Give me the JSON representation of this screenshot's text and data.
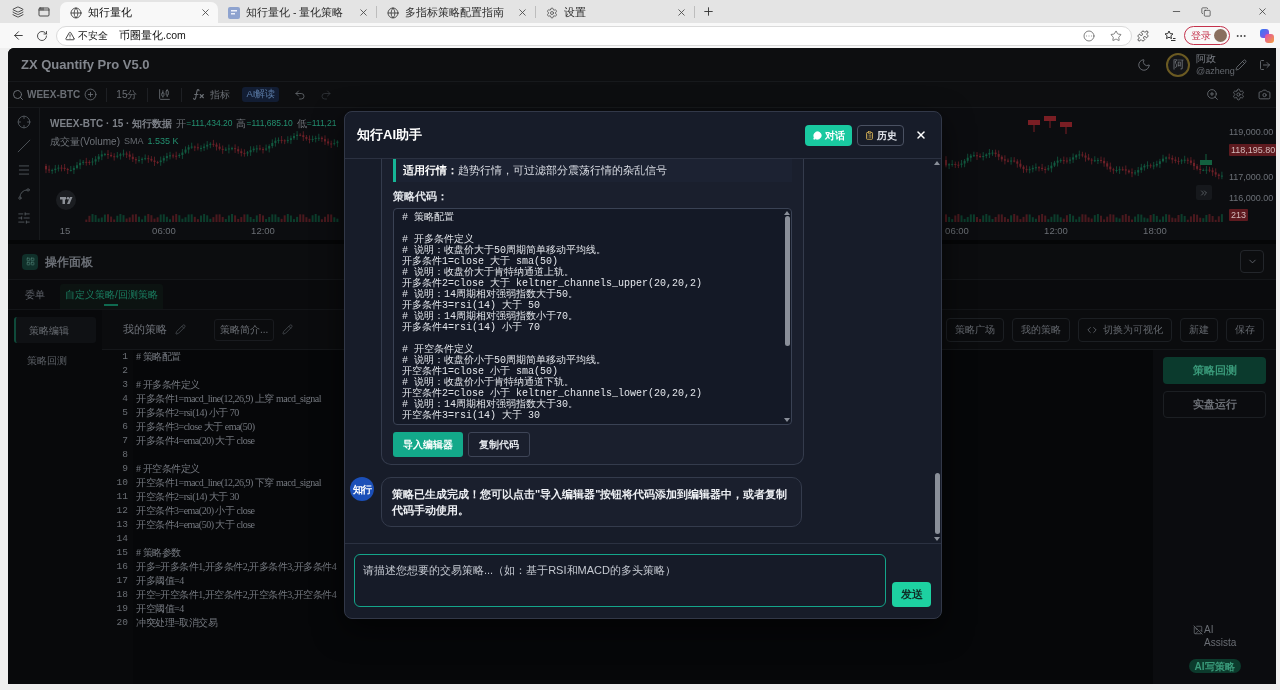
{
  "browser": {
    "tabs": [
      {
        "title": "知行量化",
        "selected": true
      },
      {
        "title": "知行量化 - 量化策略",
        "selected": false
      },
      {
        "title": "多指标策略配置指南",
        "selected": false
      },
      {
        "title": "设置",
        "selected": false
      }
    ],
    "security": "不安全",
    "url": "币圈量化.com",
    "login": "登录"
  },
  "app": {
    "title": "ZX Quantify Pro V5.0",
    "user": {
      "initial": "阿",
      "name": "阿政",
      "handle": "@azheng"
    }
  },
  "toolbar": {
    "symbol": "WEEX-BTC",
    "interval": "15分",
    "indicators": "指标",
    "ai_button": "AI解读"
  },
  "chart": {
    "title": "WEEX-BTC · 15 · 知行数据",
    "ohlc": [
      {
        "label": "开",
        "value": "=111,434.20"
      },
      {
        "label": "高",
        "value": "=111,685.10"
      },
      {
        "label": "低",
        "value": "=111,21"
      }
    ],
    "volume": {
      "label": "成交量(Volume)",
      "ma": "SMA",
      "value": "1.535 K"
    },
    "price_labels": [
      {
        "text": "119,000.00",
        "kind": "tick"
      },
      {
        "text": "118,195.80",
        "kind": "badge"
      },
      {
        "text": "117,000.00",
        "kind": "tick"
      },
      {
        "text": "116,000.00",
        "kind": "tick"
      },
      {
        "text": "213",
        "kind": "badge"
      }
    ],
    "time_labels_left": [
      "15",
      "06:00",
      "12:00"
    ],
    "time_labels_right": [
      "06:00",
      "12:00",
      "18:00"
    ]
  },
  "panel": {
    "title": "操作面板",
    "tabs": [
      {
        "label": "委单",
        "selected": false
      },
      {
        "label": "自定义策略/回测策略",
        "selected": true
      }
    ],
    "side_menu": [
      {
        "label": "策略编辑",
        "selected": true
      },
      {
        "label": "策略回测",
        "selected": false
      }
    ],
    "strategy_name": "我的策略",
    "description": "策略简介...",
    "actions": [
      {
        "label": "策略广场"
      },
      {
        "label": "我的策略"
      },
      {
        "label": "切换为可视化"
      },
      {
        "label": "新建"
      },
      {
        "label": "保存"
      }
    ],
    "editor": [
      {
        "number": "1",
        "text": "# 策略配置"
      },
      {
        "number": "2"
      },
      {
        "number": "3",
        "text": "# 开多条件定义"
      },
      {
        "number": "4",
        "text": "开多条件1=macd_line(12,26,9) 上穿 macd_signal"
      },
      {
        "number": "5",
        "text": "开多条件2=rsi(14) 小于 70"
      },
      {
        "number": "6",
        "text": "开多条件3=close 大于 ema(50)"
      },
      {
        "number": "7",
        "text": "开多条件4=ema(20) 大于 close"
      },
      {
        "number": "8"
      },
      {
        "number": "9",
        "text": "# 开空条件定义"
      },
      {
        "number": "10",
        "text": "开空条件1=macd_line(12,26,9) 下穿 macd_signal"
      },
      {
        "number": "11",
        "text": "开空条件2=rsi(14) 大于 30"
      },
      {
        "number": "12",
        "text": "开空条件3=ema(20) 小于 close"
      },
      {
        "number": "13",
        "text": "开空条件4=ema(50) 大于 close"
      },
      {
        "number": "14"
      },
      {
        "number": "15",
        "text": "# 策略参数"
      },
      {
        "number": "16",
        "text": "开多=开多条件1,开多条件2,开多条件3,开多条件4"
      },
      {
        "number": "17",
        "text": "开多阈值=4"
      },
      {
        "number": "18",
        "text": "开空=开空条件1,开空条件2,开空条件3,开空条件4"
      },
      {
        "number": "19",
        "text": "开空阈值=4"
      },
      {
        "number": "20",
        "text": "冲突处理=取消交易"
      }
    ],
    "run_buttons": [
      {
        "label": "策略回测",
        "kind": "primary"
      },
      {
        "label": "实盘运行",
        "kind": "outline"
      }
    ],
    "assistant": {
      "alt_text": "AI Assista",
      "badge": "AI写策略"
    }
  },
  "dialog": {
    "title": "知行AI助手",
    "tabs": [
      {
        "label": "对话",
        "selected": true
      },
      {
        "label": "历史",
        "selected": false
      }
    ],
    "messages": [
      {
        "kind": "strategy",
        "note": "**适用行情：**趋势行情，可过滤部分震荡行情的杂乱信号",
        "code_label": "策略代码：",
        "code_groups": [
          [
            "# 策略配置"
          ],
          [
            "# 开多条件定义",
            "# 说明：收盘价大于50周期简单移动平均线。",
            "开多条件1=close 大于 sma(50)",
            "# 说明：收盘价大于肯特纳通道上轨。",
            "开多条件2=close 大于 keltner_channels_upper(20,20,2)",
            "# 说明：14周期相对强弱指数大于50。",
            "开多条件3=rsi(14) 大于 50",
            "# 说明：14周期相对强弱指数小于70。",
            "开多条件4=rsi(14) 小于 70"
          ],
          [
            "# 开空条件定义",
            "# 说明：收盘价小于50周期简单移动平均线。",
            "开空条件1=close 小于 sma(50)",
            "# 说明：收盘价小于肯特纳通道下轨。",
            "开空条件2=close 小于 keltner_channels_lower(20,20,2)",
            "# 说明：14周期相对强弱指数大于30。",
            "开空条件3=rsi(14) 大于 30"
          ]
        ],
        "buttons": [
          {
            "label": "导入编辑器",
            "kind": "primary"
          },
          {
            "label": "复制代码",
            "kind": "outline"
          }
        ]
      },
      {
        "kind": "text",
        "avatar": "知行",
        "text": "策略已生成完成！您可以点击\"导入编辑器\"按钮将代码添加到编辑器中，或者复制代码手动使用。"
      }
    ],
    "input": {
      "placeholder": "请描述您想要的交易策略...（如：基于RSI和MACD的多头策略）",
      "send": "发送"
    }
  }
}
